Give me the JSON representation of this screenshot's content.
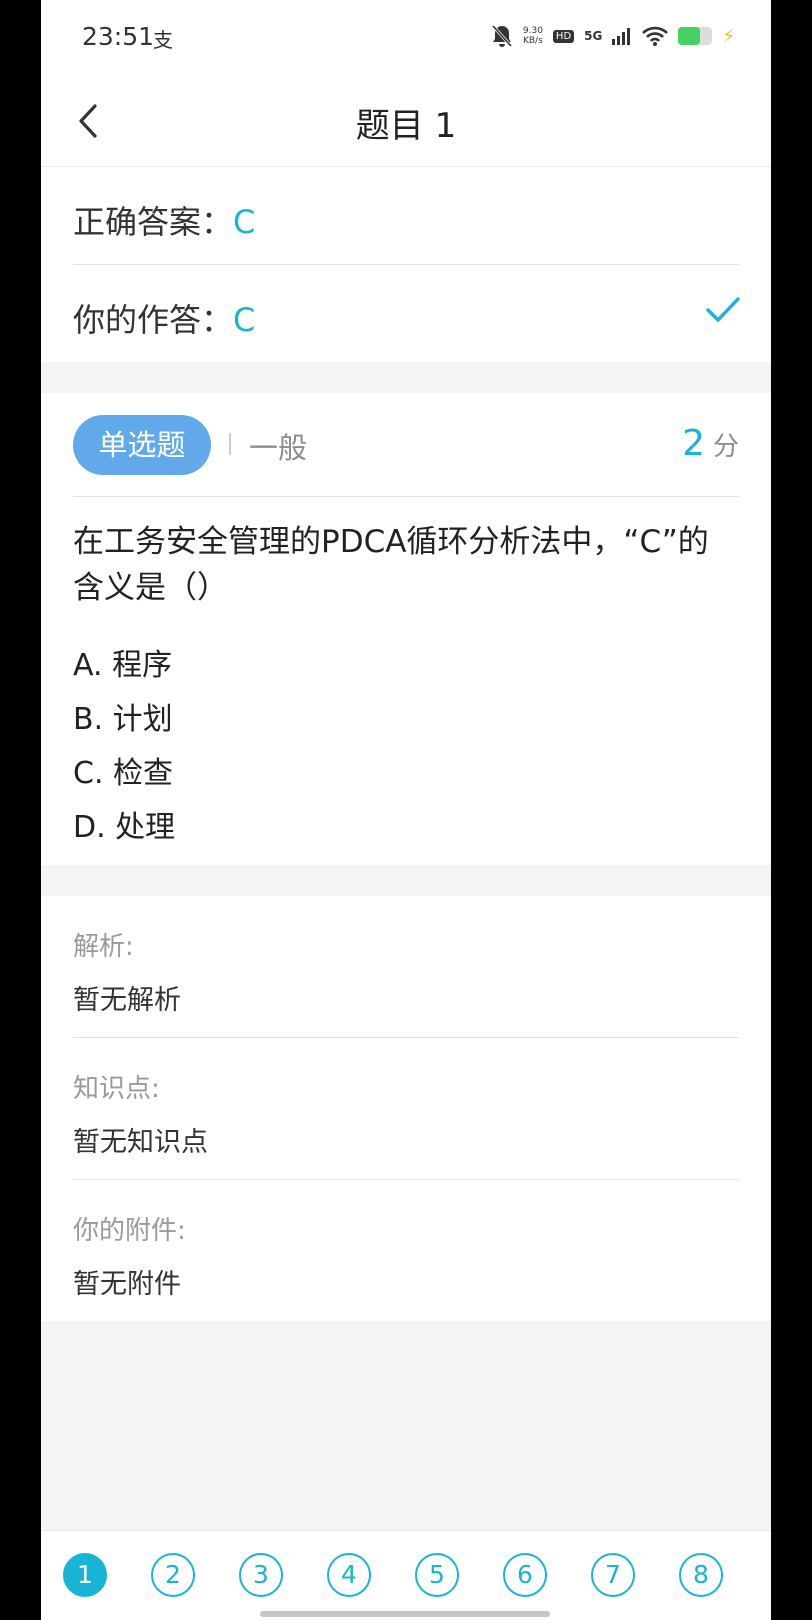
{
  "status_bar": {
    "time": "23:51",
    "alipay_glyph": "支",
    "net_speed_value": "9.30",
    "net_speed_unit": "KB/s",
    "hd": "HD",
    "network": "5G",
    "icons": [
      "bell-mute-icon",
      "signal-icon",
      "wifi-icon",
      "battery-icon",
      "charging-icon"
    ]
  },
  "header": {
    "title": "题目 1"
  },
  "answer": {
    "correct_label": "正确答案：",
    "correct_value": "C",
    "yours_label": "你的作答：",
    "yours_value": "C"
  },
  "question": {
    "type_tag": "单选题",
    "difficulty": "一般",
    "score": "2",
    "score_unit": "分",
    "text": "在工务安全管理的PDCA循环分析法中，“C”的含义是（）",
    "options": [
      "A. 程序",
      "B. 计划",
      "C. 检查",
      "D. 处理"
    ]
  },
  "analysis": {
    "analysis_label": "解析:",
    "analysis_value": "暂无解析",
    "knowledge_label": "知识点:",
    "knowledge_value": "暂无知识点",
    "attachment_label": "你的附件:",
    "attachment_value": "暂无附件"
  },
  "nav": {
    "numbers": [
      "1",
      "2",
      "3",
      "4",
      "5",
      "6",
      "7",
      "8"
    ],
    "active": "1"
  },
  "colors": {
    "accent": "#18b4d6",
    "tag": "#62a9ec"
  }
}
